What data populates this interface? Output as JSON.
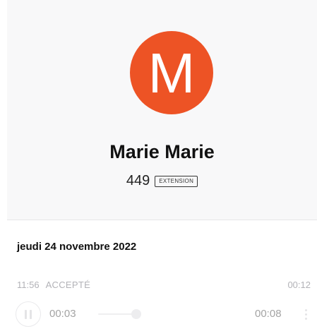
{
  "contact": {
    "initial": "M",
    "name": "Marie Marie",
    "number": "449",
    "number_type": "EXTENSION",
    "avatar_color": "#ed5325"
  },
  "history": {
    "date": "jeudi 24 novembre 2022",
    "calls": [
      {
        "time": "11:56",
        "status": "ACCEPTÉ",
        "duration": "00:12",
        "player": {
          "state_icon": "pause-icon",
          "current_time": "00:03",
          "total_time": "00:08",
          "more_icon": "more-vertical-icon"
        }
      }
    ]
  },
  "colors": {
    "header_background": "#f8f8f9",
    "muted_text": "#a5a5ab"
  }
}
